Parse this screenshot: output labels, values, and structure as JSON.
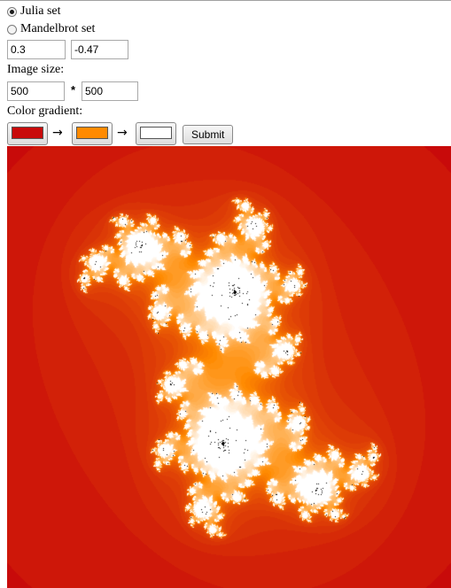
{
  "fractal_type": {
    "options": [
      {
        "label": "Julia set",
        "checked": true
      },
      {
        "label": "Mandelbrot set",
        "checked": false
      }
    ]
  },
  "constant": {
    "real": "0.3",
    "imag": "-0.47"
  },
  "image_size": {
    "label": "Image size:",
    "width": "500",
    "times": "*",
    "height": "500"
  },
  "gradient": {
    "label": "Color gradient:",
    "arrow": "→",
    "colors": [
      "#c80a0a",
      "#ff8a00",
      "#ffffff"
    ],
    "submit_label": "Submit"
  }
}
